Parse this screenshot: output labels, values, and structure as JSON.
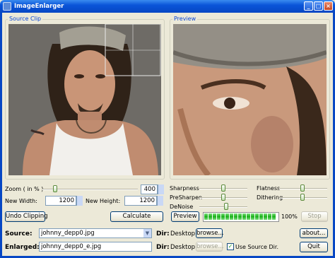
{
  "window": {
    "title": "ImageEnlarger"
  },
  "source_clip": {
    "label": "Source Clip"
  },
  "preview": {
    "label": "Preview"
  },
  "zoom": {
    "label": "Zoom  ( in % )",
    "value": "400",
    "slider_fraction": 0.15
  },
  "size": {
    "width_label": "New Width:",
    "width_value": "1200",
    "height_label": "New Height:",
    "height_value": "1200"
  },
  "buttons": {
    "undo_clipping": "Undo Clipping",
    "calculate": "Calculate",
    "preview": "Preview",
    "stop": "Stop",
    "about": "about...",
    "quit": "Quit",
    "browse": "browse..."
  },
  "adjust": {
    "sharpness": "Sharpness",
    "presharpen": "PreSharpen",
    "denoise": "DeNoise",
    "flatness": "Flatness",
    "dithering": "Dithering"
  },
  "progress": {
    "value": "100%",
    "fraction": 1.0
  },
  "source": {
    "label": "Source:",
    "file": "johnny_depp0.jpg",
    "dir_label": "Dir:",
    "dir": "Desktop"
  },
  "enlarged": {
    "label": "Enlarged:",
    "file": "johnny_depp0_e.jpg",
    "dir_label": "Dir:",
    "dir": "Desktop",
    "use_source_label": "Use Source Dir.",
    "use_source_checked": true
  },
  "colors": {
    "titlebar": "#0747c4",
    "accent": "#0a46d4",
    "progress": "#19b019"
  }
}
